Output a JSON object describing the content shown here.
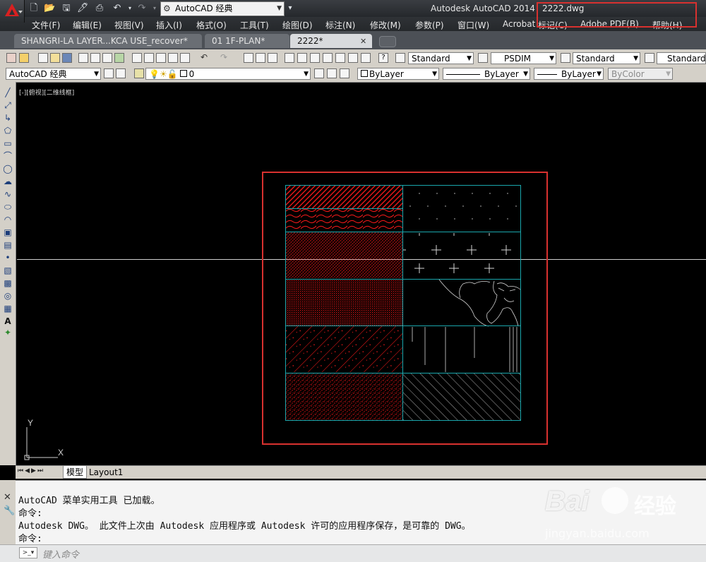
{
  "titlebar": {
    "app_title": "Autodesk AutoCAD 2014",
    "file_title": "2222.dwg",
    "workspace": "AutoCAD 经典"
  },
  "menu": [
    "文件(F)",
    "编辑(E)",
    "视图(V)",
    "插入(I)",
    "格式(O)",
    "工具(T)",
    "绘图(D)",
    "标注(N)",
    "修改(M)",
    "参数(P)",
    "窗口(W)",
    "Acrobat",
    "标记(C)",
    "Adobe PDF(B)",
    "帮助(H)"
  ],
  "tabs": [
    {
      "label": "SHANGRI-LA LAYER...KCA USE_recover*",
      "active": false
    },
    {
      "label": "01 1F-PLAN*",
      "active": false
    },
    {
      "label": "2222*",
      "active": true
    }
  ],
  "toolbar1": {
    "text_style": "Standard",
    "dim_style": "PSDIM",
    "table_style": "Standard",
    "mleader_style": "Standard"
  },
  "toolbar2": {
    "workspace": "AutoCAD 经典",
    "layer": "0",
    "color": "ByLayer",
    "linetype": "ByLayer",
    "lineweight": "ByLayer",
    "plotstyle": "ByColor"
  },
  "viewport_label": "[-][俯视][二维线框]",
  "ucs": {
    "x": "X",
    "y": "Y"
  },
  "layout_tabs": [
    "模型",
    "Layout1"
  ],
  "command_history": [
    "AutoCAD 菜单实用工具 已加载。",
    "命令:",
    "Autodesk DWG。  此文件上次由 Autodesk 应用程序或 Autodesk 许可的应用程序保存，是可靠的 DWG。",
    "命令:"
  ],
  "command_placeholder": "键入命令",
  "watermark": {
    "brand": "Bai",
    "brand_suffix": "经验",
    "url": "jingyan.baidu.com"
  },
  "colors": {
    "highlight": "#d8312f",
    "cyan": "#1aa6ac",
    "hatch_red": "#e01515",
    "hatch_white": "#d6d6d6"
  }
}
